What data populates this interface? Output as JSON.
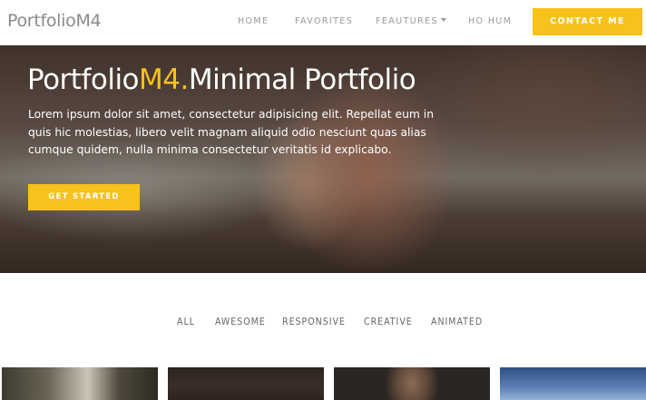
{
  "navbar": {
    "brand": "PortfolioM4",
    "items": [
      {
        "label": "HOME"
      },
      {
        "label": "FAVORITES"
      },
      {
        "label": "FEAUTURES"
      },
      {
        "label": "HO HUM"
      }
    ],
    "contact_label": "CONTACT ME"
  },
  "hero": {
    "title_part1": "Portfolio",
    "title_accent": "M4.",
    "title_part2": "Minimal Portfolio",
    "text": "Lorem ipsum dolor sit amet, consectetur adipisicing elit. Repellat eum in quis hic molestias, libero velit magnam aliquid odio nesciunt quas alias cumque quidem, nulla minima consectetur veritatis id explicabo.",
    "cta_label": "GET STARTED"
  },
  "filters": [
    "ALL",
    "AWESOME",
    "RESPONSIVE",
    "CREATIVE",
    "ANIMATED"
  ],
  "colors": {
    "accent": "#f8c21c",
    "nav_text": "#9a9a9a"
  }
}
